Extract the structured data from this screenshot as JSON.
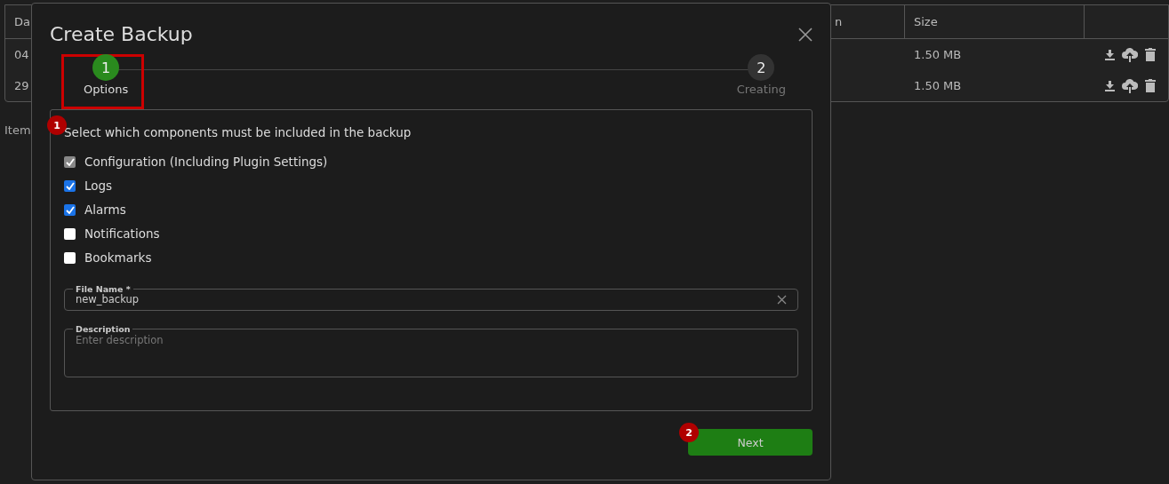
{
  "table": {
    "columns": [
      {
        "label": "Da"
      },
      {
        "label": "n"
      },
      {
        "label": "Size"
      }
    ],
    "rows": [
      {
        "column_1": "04",
        "size": "1.50 MB"
      },
      {
        "column_1": "29",
        "size": "1.50 MB"
      }
    ]
  },
  "footer_text": "Item",
  "dialog": {
    "title": "Create Backup",
    "steps": [
      {
        "number": "1",
        "label": "Options",
        "selected": true
      },
      {
        "number": "2",
        "label": "Creating",
        "selected": false
      }
    ],
    "heading": "Select which components must be included in the backup",
    "components": [
      {
        "label": "Configuration (Including Plugin Settings)",
        "checked": true,
        "disabled": true
      },
      {
        "label": "Logs",
        "checked": true,
        "disabled": false
      },
      {
        "label": "Alarms",
        "checked": true,
        "disabled": false
      },
      {
        "label": "Notifications",
        "checked": false,
        "disabled": false
      },
      {
        "label": "Bookmarks",
        "checked": false,
        "disabled": false
      }
    ],
    "file_name": {
      "label": "File Name *",
      "value": "new_backup"
    },
    "description": {
      "label": "Description",
      "placeholder": "Enter description"
    },
    "next_button": "Next"
  },
  "annotations": [
    {
      "number": "1"
    },
    {
      "number": "2"
    }
  ]
}
